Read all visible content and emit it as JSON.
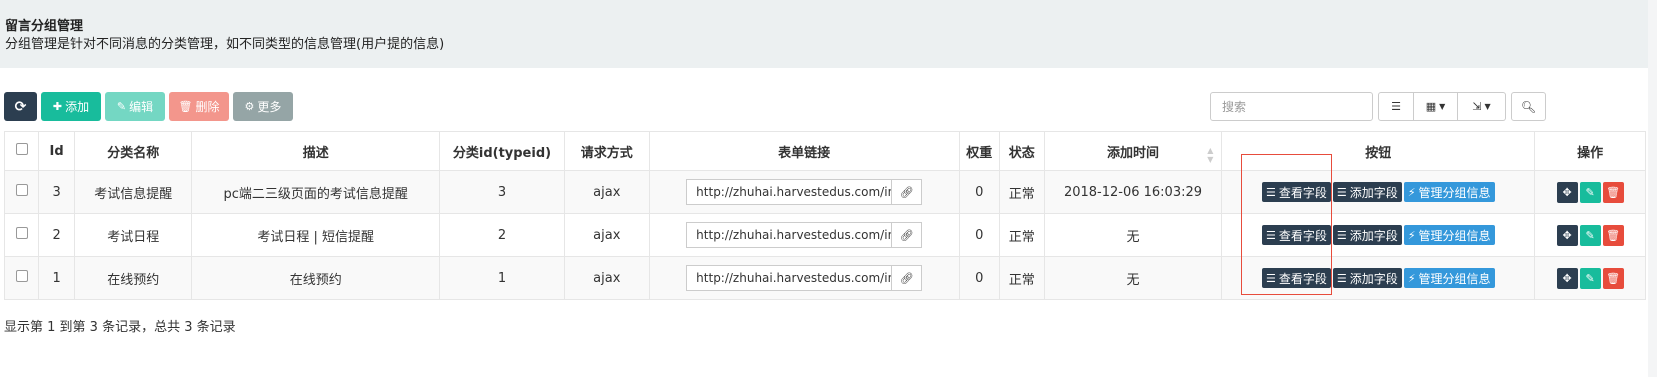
{
  "header": {
    "title": "留言分组管理",
    "description": "分组管理是针对不同消息的分类管理，如不同类型的信息管理(用户提的信息)"
  },
  "toolbar": {
    "refresh_icon": "refresh-icon",
    "add_label": "添加",
    "edit_label": "编辑",
    "delete_label": "删除",
    "more_label": "更多"
  },
  "search": {
    "placeholder": "搜索"
  },
  "table": {
    "columns": [
      "Id",
      "分类名称",
      "描述",
      "分类id(typeid)",
      "请求方式",
      "表单链接",
      "权重",
      "状态",
      "添加时间",
      "按钮",
      "操作"
    ],
    "rows": [
      {
        "id": "3",
        "name": "考试信息提醒",
        "desc": "pc端二三级页面的考试信息提醒",
        "typeid": "3",
        "method": "ajax",
        "link": "http://zhuhai.harvestedus.com/index/",
        "weight": "0",
        "status": "正常",
        "time": "2018-12-06 16:03:29"
      },
      {
        "id": "2",
        "name": "考试日程",
        "desc": "考试日程 | 短信提醒",
        "typeid": "2",
        "method": "ajax",
        "link": "http://zhuhai.harvestedus.com/index/",
        "weight": "0",
        "status": "正常",
        "time": "无"
      },
      {
        "id": "1",
        "name": "在线预约",
        "desc": "在线预约",
        "typeid": "1",
        "method": "ajax",
        "link": "http://zhuhai.harvestedus.com/index/",
        "weight": "0",
        "status": "正常",
        "time": "无"
      }
    ],
    "row_buttons": {
      "view_fields": "查看字段",
      "add_field": "添加字段",
      "manage_group": "管理分组信息"
    }
  },
  "footer": {
    "summary": "显示第 1 到第 3 条记录，总共 3 条记录"
  },
  "colors": {
    "dark": "#2c3e50",
    "green": "#18bc9c",
    "red": "#e74c3c",
    "blue": "#3498db",
    "gray": "#95a5a6"
  }
}
